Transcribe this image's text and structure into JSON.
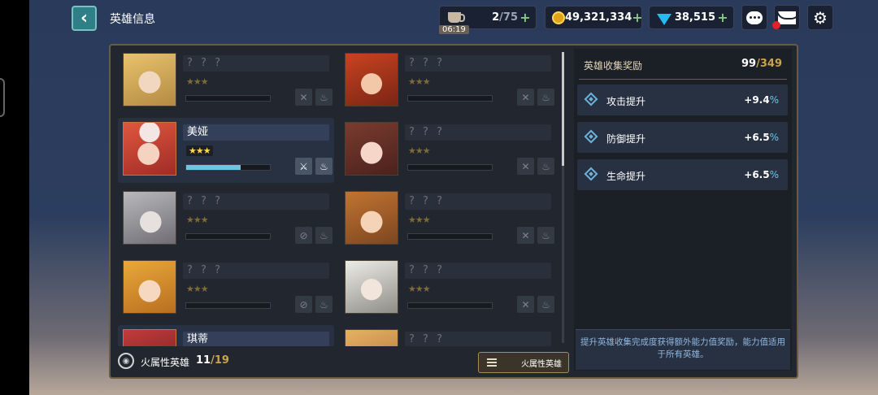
{
  "header": {
    "back_icon": "chevron-left-icon",
    "title": "英雄信息"
  },
  "resources": {
    "stamina": {
      "current": "2",
      "max": "/75",
      "timer": "06:19",
      "icon": "cup-icon"
    },
    "gold": {
      "value": "49,321,334",
      "icon": "coin-icon"
    },
    "gems": {
      "value": "38,515",
      "icon": "gem-icon"
    },
    "plus": "+"
  },
  "toolbar": {
    "chat_icon": "chat-icon",
    "mail_icon": "mail-icon",
    "settings_icon": "gear-icon"
  },
  "heroes": [
    {
      "name": "? ? ?",
      "stars": "★★★",
      "progress": 0,
      "unlocked": false
    },
    {
      "name": "? ? ?",
      "stars": "★★★",
      "progress": 0,
      "unlocked": false
    },
    {
      "name": "美娅",
      "stars": "★★★",
      "progress": 0.65,
      "unlocked": true
    },
    {
      "name": "? ? ?",
      "stars": "★★★",
      "progress": 0,
      "unlocked": false
    },
    {
      "name": "? ? ?",
      "stars": "★★★",
      "progress": 0,
      "unlocked": false
    },
    {
      "name": "? ? ?",
      "stars": "★★★",
      "progress": 0,
      "unlocked": false
    },
    {
      "name": "? ? ?",
      "stars": "★★★",
      "progress": 0,
      "unlocked": false
    },
    {
      "name": "? ? ?",
      "stars": "★★★",
      "progress": 0,
      "unlocked": false
    },
    {
      "name": "琪蒂",
      "stars": "",
      "progress": 0,
      "unlocked": true
    },
    {
      "name": "? ? ?",
      "stars": "",
      "progress": 0,
      "unlocked": false
    }
  ],
  "footer": {
    "attribute_label": "火属性英雄",
    "count": "11",
    "max": "/19",
    "filter_label": "火属性英雄"
  },
  "collection": {
    "title": "英雄收集奖励",
    "count": "99",
    "max": "/349",
    "bonuses": [
      {
        "label": "攻击提升",
        "value": "+9.4",
        "unit": "%"
      },
      {
        "label": "防御提升",
        "value": "+6.5",
        "unit": "%"
      },
      {
        "label": "生命提升",
        "value": "+6.5",
        "unit": "%"
      }
    ],
    "note": "提升英雄收集完成度获得额外能力值奖励，能力值适用于所有英雄。"
  },
  "colors": {
    "accent_gold": "#c9a34f",
    "accent_blue": "#6cc6e3",
    "panel_border": "#6b5b43"
  }
}
